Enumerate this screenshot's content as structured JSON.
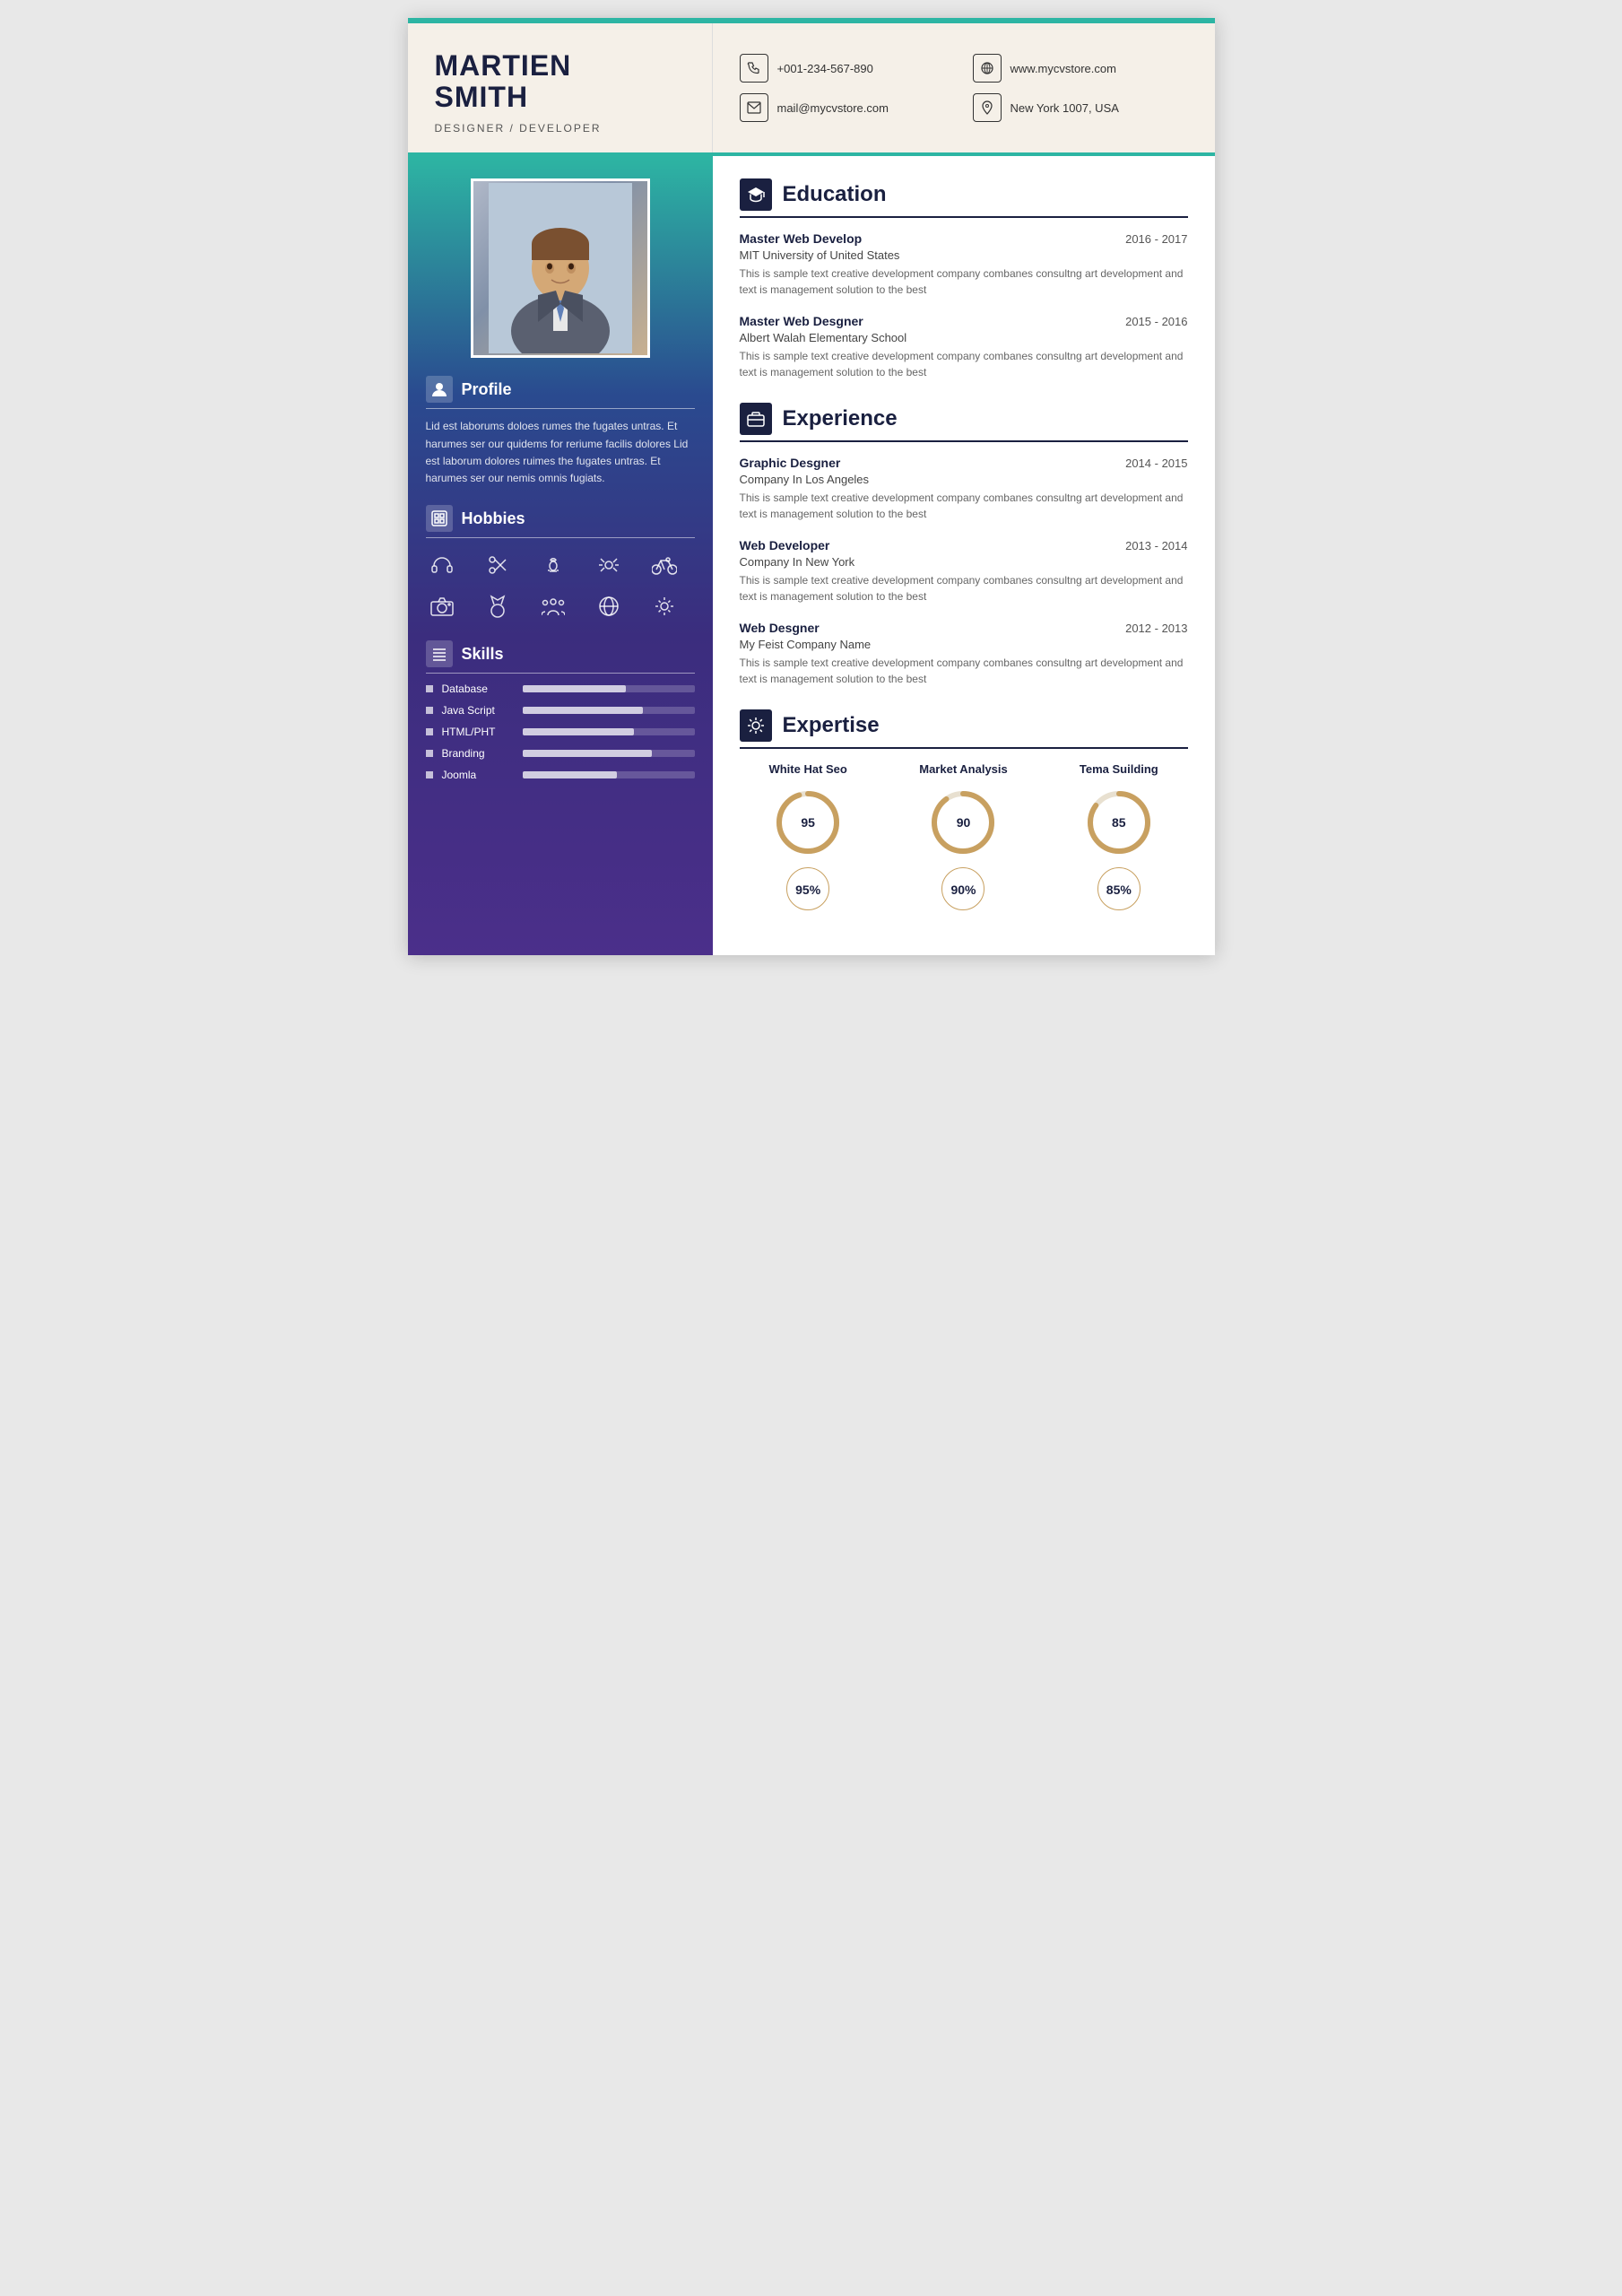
{
  "header": {
    "name_line1": "MARTIEN",
    "name_line2": "SMITH",
    "title": "DESIGNER / DEVELOPER",
    "contacts": [
      {
        "icon": "phone",
        "text": "+001-234-567-890",
        "unicode": "📞"
      },
      {
        "icon": "web",
        "text": "www.mycvstore.com",
        "unicode": "🖱"
      },
      {
        "icon": "email",
        "text": "mail@mycvstore.com",
        "unicode": "✉"
      },
      {
        "icon": "location",
        "text": "New York 1007, USA",
        "unicode": "📍"
      }
    ]
  },
  "sidebar": {
    "profile_section_title": "Profile",
    "profile_text": "Lid est laborums doloes rumes the fugates untras. Et harumes ser our quidems for reriume facilis dolores Lid est laborum dolores ruimes the fugates untras. Et harumes ser our nemis omnis fugiats.",
    "hobbies_section_title": "Hobbies",
    "hobbies": [
      "🎧",
      "✂",
      "♟",
      "📡",
      "🚲",
      "📷",
      "🏅",
      "👥",
      "🌐",
      "⚙"
    ],
    "skills_section_title": "Skills",
    "skills": [
      {
        "name": "Database",
        "percent": 60
      },
      {
        "name": "Java Script",
        "percent": 70
      },
      {
        "name": "HTML/PHT",
        "percent": 65
      },
      {
        "name": "Branding",
        "percent": 75
      },
      {
        "name": "Joomla",
        "percent": 55
      }
    ]
  },
  "education": {
    "section_title": "Education",
    "entries": [
      {
        "title": "Master Web Develop",
        "date": "2016 - 2017",
        "subtitle": "MIT University of United States",
        "desc": "This is sample text creative development company combanes consultng art development and text is management solution to the best"
      },
      {
        "title": "Master Web Desgner",
        "date": "2015 - 2016",
        "subtitle": "Albert Walah Elementary School",
        "desc": "This is sample text creative development company combanes consultng art development and text is management solution to the best"
      }
    ]
  },
  "experience": {
    "section_title": "Experience",
    "entries": [
      {
        "title": "Graphic Desgner",
        "date": "2014 - 2015",
        "subtitle": "Company In Los Angeles",
        "desc": "This is sample text creative development company combanes consultng art development and text is management solution to the best"
      },
      {
        "title": "Web Developer",
        "date": "2013 - 2014",
        "subtitle": "Company In New York",
        "desc": "This is sample text creative development company combanes consultng art development and text is management solution to the best"
      },
      {
        "title": "Web Desgner",
        "date": "2012 - 2013",
        "subtitle": "My Feist Company Name",
        "desc": "This is sample text creative development company combanes consultng art development and text is management solution to the best"
      }
    ]
  },
  "expertise": {
    "section_title": "Expertise",
    "items": [
      {
        "label": "White Hat Seo",
        "percent": 95
      },
      {
        "label": "Market Analysis",
        "percent": 90
      },
      {
        "label": "Tema Suilding",
        "percent": 85
      }
    ]
  }
}
